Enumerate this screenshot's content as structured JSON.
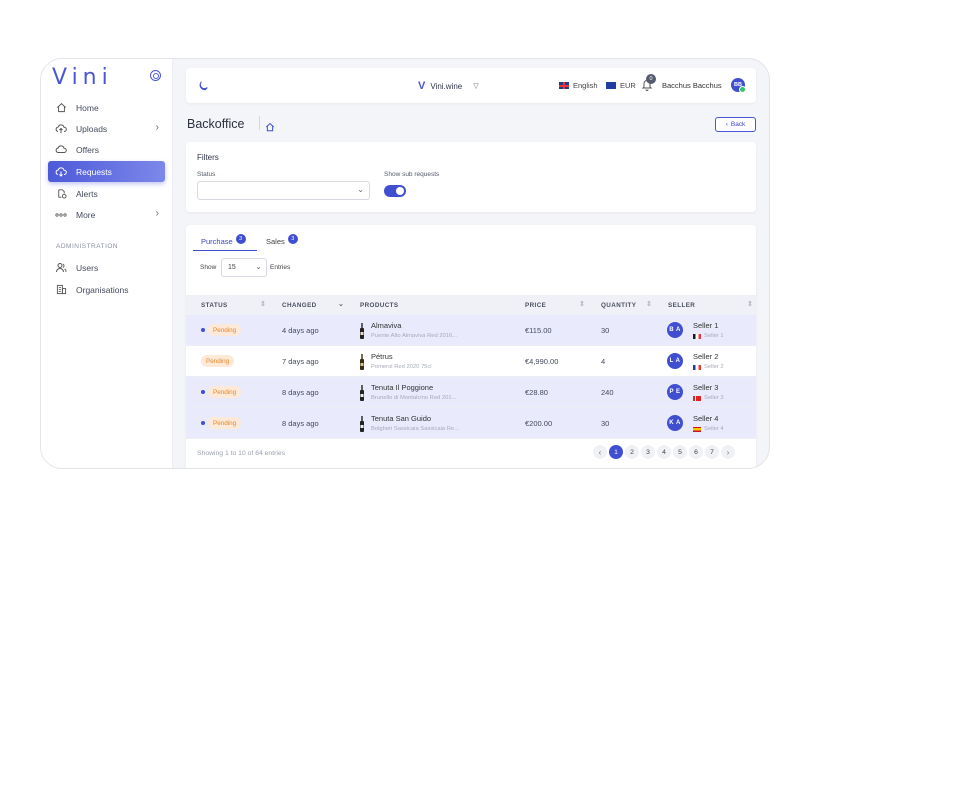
{
  "sidebar": {
    "logo": "Vini",
    "items": [
      {
        "label": "Home",
        "icon": "home-icon"
      },
      {
        "label": "Uploads",
        "icon": "cloud-upload-icon",
        "has_chevron": true
      },
      {
        "label": "Offers",
        "icon": "cloud-icon"
      },
      {
        "label": "Requests",
        "icon": "requests-icon",
        "active": true
      },
      {
        "label": "Alerts",
        "icon": "alert-icon"
      },
      {
        "label": "More",
        "icon": "more-icon",
        "has_chevron": true
      }
    ],
    "section_title": "ADMINISTRATION",
    "admin_items": [
      {
        "label": "Users",
        "icon": "users-icon"
      },
      {
        "label": "Organisations",
        "icon": "building-icon"
      }
    ]
  },
  "topbar": {
    "brand": "Vini.wine",
    "language": "English",
    "currency": "EUR",
    "notifications_count": "0",
    "username": "Bacchus Bacchus",
    "avatar_initials": "BB"
  },
  "page": {
    "title": "Backoffice",
    "back_label": "Back"
  },
  "filters": {
    "title": "Filters",
    "status_label": "Status",
    "status_value": "",
    "sub_requests_label": "Show sub requests",
    "sub_requests_on": true
  },
  "tabs": [
    {
      "label": "Purchase",
      "count": "3",
      "active": true
    },
    {
      "label": "Sales",
      "count": "3",
      "active": false
    }
  ],
  "page_size": {
    "show_label": "Show",
    "value": "15",
    "entries_label": "Entries"
  },
  "table": {
    "columns": [
      "STATUS",
      "CHANGED",
      "PRODUCTS",
      "PRICE",
      "QUANTITY",
      "SELLER"
    ],
    "rows": [
      {
        "status": "Pending",
        "changed": "4 days ago",
        "product": "Almaviva",
        "product_sub": "Puente Alto Almaviva Red 2016...",
        "price": "€115.00",
        "quantity": "30",
        "seller_initials": "B A",
        "seller": "Seller 1",
        "seller_sub": "Seller 1"
      },
      {
        "status": "Pending",
        "changed": "7 days ago",
        "product": "Pétrus",
        "product_sub": "Pomerol Red 2020 75cl",
        "price": "€4,990.00",
        "quantity": "4",
        "seller_initials": "L A",
        "seller": "Seller 2",
        "seller_sub": "Seller 2"
      },
      {
        "status": "Pending",
        "changed": "8 days ago",
        "product": "Tenuta Il Poggione",
        "product_sub": "Brunello di Montalcino Red 201...",
        "price": "€28.80",
        "quantity": "240",
        "seller_initials": "P E",
        "seller": "Seller 3",
        "seller_sub": "Seller 3"
      },
      {
        "status": "Pending",
        "changed": "8 days ago",
        "product": "Tenuta San Guido",
        "product_sub": "Bolgheri Sassicaia Sassicaia Re...",
        "price": "€200.00",
        "quantity": "30",
        "seller_initials": "K A",
        "seller": "Seller 4",
        "seller_sub": "Seller 4"
      }
    ]
  },
  "footer": {
    "info": "Showing 1 to 10 of 64 entries",
    "pages": [
      "1",
      "2",
      "3",
      "4",
      "5",
      "6",
      "7"
    ],
    "prev": "‹",
    "next": "›"
  },
  "colors": {
    "accent": "#3f4fd0",
    "pending_bg": "#fde9d7",
    "pending_text": "#e6872a",
    "row_highlight": "#e9eafc"
  }
}
